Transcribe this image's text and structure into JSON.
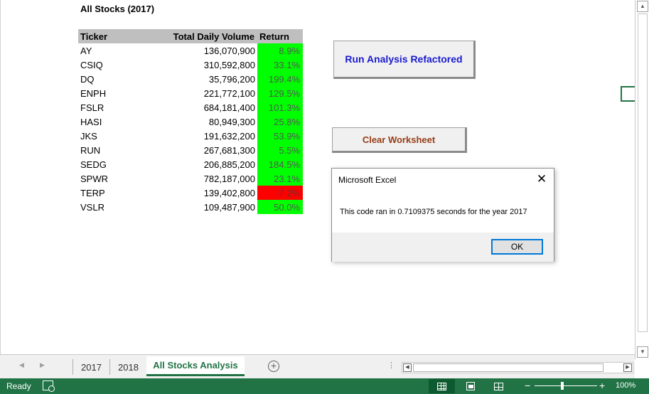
{
  "sheet": {
    "title": "All Stocks (2017)",
    "headers": {
      "ticker": "Ticker",
      "volume": "Total Daily Volume",
      "return": "Return"
    },
    "rows": [
      {
        "ticker": "AY",
        "volume": "136,070,900",
        "return": "8.9%",
        "status": "positive"
      },
      {
        "ticker": "CSIQ",
        "volume": "310,592,800",
        "return": "33.1%",
        "status": "positive"
      },
      {
        "ticker": "DQ",
        "volume": "35,796,200",
        "return": "199.4%",
        "status": "positive"
      },
      {
        "ticker": "ENPH",
        "volume": "221,772,100",
        "return": "129.5%",
        "status": "positive"
      },
      {
        "ticker": "FSLR",
        "volume": "684,181,400",
        "return": "101.3%",
        "status": "positive"
      },
      {
        "ticker": "HASI",
        "volume": "80,949,300",
        "return": "25.8%",
        "status": "positive"
      },
      {
        "ticker": "JKS",
        "volume": "191,632,200",
        "return": "53.9%",
        "status": "positive"
      },
      {
        "ticker": "RUN",
        "volume": "267,681,300",
        "return": "5.5%",
        "status": "positive"
      },
      {
        "ticker": "SEDG",
        "volume": "206,885,200",
        "return": "184.5%",
        "status": "positive"
      },
      {
        "ticker": "SPWR",
        "volume": "782,187,000",
        "return": "23.1%",
        "status": "positive"
      },
      {
        "ticker": "TERP",
        "volume": "139,402,800",
        "return": "-7.2%",
        "status": "negative"
      },
      {
        "ticker": "VSLR",
        "volume": "109,487,900",
        "return": "50.0%",
        "status": "positive"
      }
    ]
  },
  "buttons": {
    "run_analysis": "Run Analysis Refactored",
    "clear_worksheet": "Clear Worksheet"
  },
  "dialog": {
    "title": "Microsoft Excel",
    "close_glyph": "✕",
    "message": "This code ran in 0.7109375 seconds for the year 2017",
    "ok_label": "OK"
  },
  "tabs": [
    {
      "label": "2017",
      "active": false
    },
    {
      "label": "2018",
      "active": false
    },
    {
      "label": "All Stocks Analysis",
      "active": true
    }
  ],
  "status_bar": {
    "status": "Ready",
    "zoom": "100%",
    "active_view": "normal"
  },
  "icons": {
    "scroll_up": "▲",
    "scroll_down": "▼",
    "scroll_left": "◀",
    "scroll_right": "▶",
    "tab_prev": "◀",
    "tab_next": "▶",
    "add_sheet": "+",
    "zoom_minus": "−",
    "zoom_plus": "+",
    "tab_dots": "⋮"
  },
  "colors": {
    "excel_green": "#217346",
    "positive_fill": "#00ff00",
    "negative_fill": "#ff0000",
    "header_fill": "#bfbfbf",
    "run_button_text": "#1a1ad0",
    "clear_button_text": "#963c14"
  }
}
